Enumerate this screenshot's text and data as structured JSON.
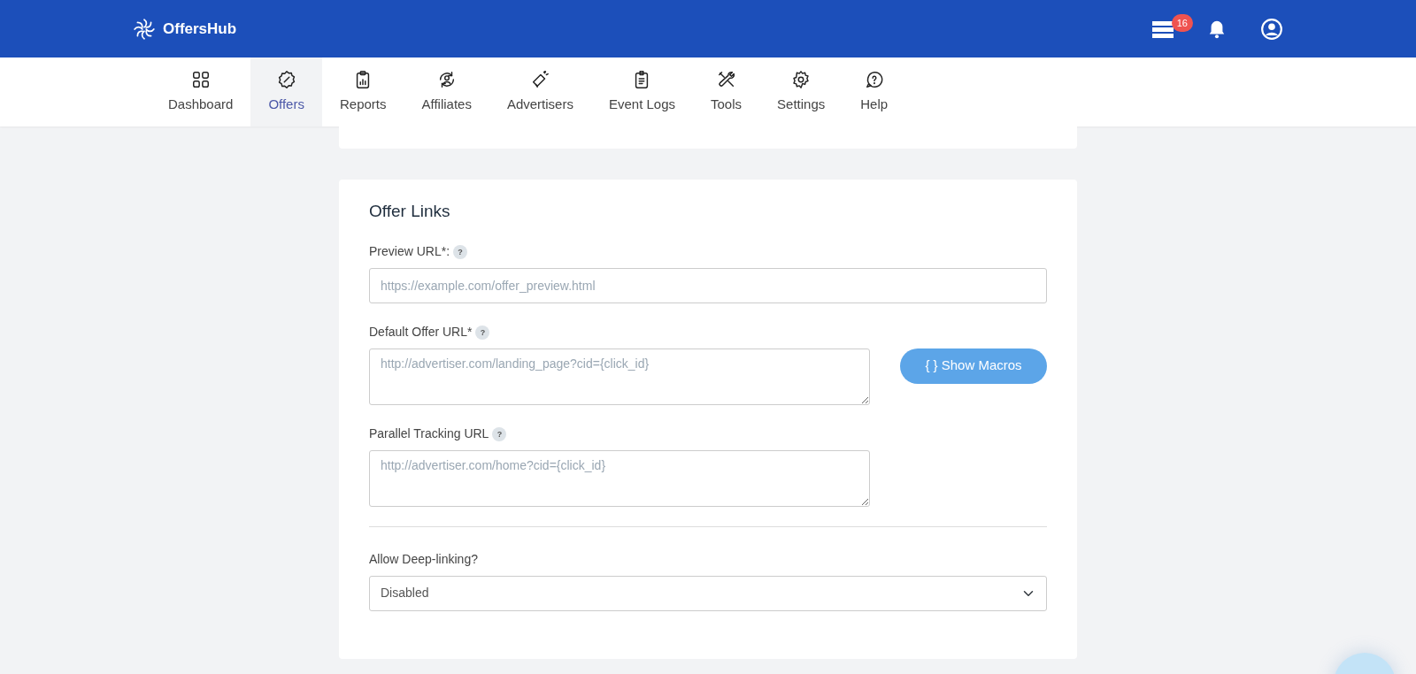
{
  "header": {
    "brand": "OffersHub",
    "notification_count": "16"
  },
  "nav": [
    {
      "label": "Dashboard",
      "selected": false
    },
    {
      "label": "Offers",
      "selected": true
    },
    {
      "label": "Reports",
      "selected": false
    },
    {
      "label": "Affiliates",
      "selected": false
    },
    {
      "label": "Advertisers",
      "selected": false
    },
    {
      "label": "Event Logs",
      "selected": false
    },
    {
      "label": "Tools",
      "selected": false
    },
    {
      "label": "Settings",
      "selected": false
    },
    {
      "label": "Help",
      "selected": false
    }
  ],
  "card": {
    "title": "Offer Links",
    "fields": [
      {
        "kind": "input",
        "label": "Preview URL*:",
        "help": "?",
        "placeholder": "https://example.com/offer_preview.html"
      },
      {
        "kind": "textarea",
        "label": "Default Offer URL*",
        "help": "?",
        "placeholder": "http://advertiser.com/landing_page?cid={click_id}",
        "button": "{ } Show Macros"
      },
      {
        "kind": "textarea",
        "label": "Parallel Tracking URL",
        "help": "?",
        "placeholder": "http://advertiser.com/home?cid={click_id}"
      },
      {
        "kind": "divider"
      },
      {
        "kind": "select",
        "label": "Allow Deep-linking?",
        "value": "Disabled"
      }
    ]
  }
}
